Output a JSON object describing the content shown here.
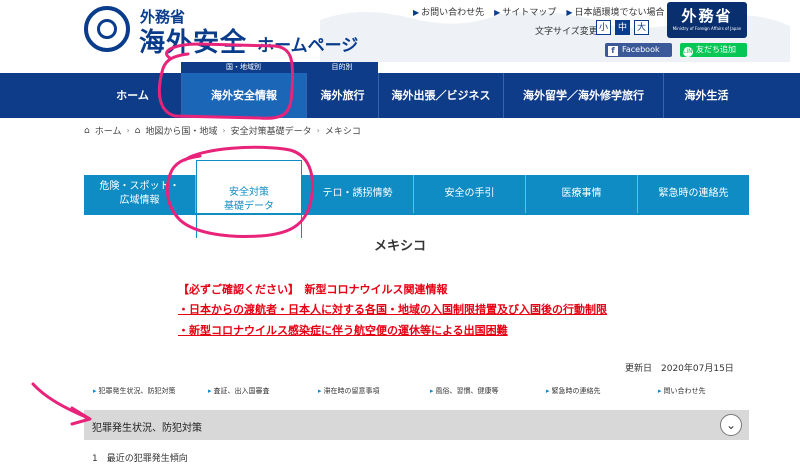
{
  "header": {
    "logo_small": "外務省",
    "logo_big": "海外安全",
    "logo_sub": "ホームページ",
    "links": [
      "お問い合わせ先",
      "サイトマップ",
      "日本語環境でない場合"
    ],
    "fontsize_label": "文字サイズ変更",
    "fontsize_options": [
      "小",
      "中",
      "大"
    ],
    "mofa_jp": "外務省",
    "mofa_en": "Ministry of Foreign Affairs of Japan",
    "facebook": "Facebook",
    "line": "友だち追加"
  },
  "nav": {
    "cat_region": "国・地域別",
    "cat_purpose": "目的別",
    "items": [
      "ホーム",
      "海外安全情報",
      "海外旅行",
      "海外出張／ビジネス",
      "海外留学／海外修学旅行",
      "海外生活"
    ]
  },
  "breadcrumb": [
    "ホーム",
    "地図から国・地域",
    "安全対策基礎データ",
    "メキシコ"
  ],
  "tabs": [
    {
      "l1": "危険・スポット・",
      "l2": "広域情報"
    },
    {
      "l1": "安全対策",
      "l2": "基礎データ"
    },
    {
      "l1": "テロ・誘拐情勢",
      "l2": ""
    },
    {
      "l1": "安全の手引",
      "l2": ""
    },
    {
      "l1": "医療事情",
      "l2": ""
    },
    {
      "l1": "緊急時の連絡先",
      "l2": ""
    }
  ],
  "page_title": "メキシコ",
  "notice": {
    "heading": "【必ずご確認ください】　新型コロナウイルス関連情報",
    "link1": "・日本からの渡航者・日本人に対する各国・地域の入国制限措置及び入国後の行動制限",
    "link2": "・新型コロナウイルス感染症に伴う航空便の運休等による出国困難"
  },
  "updated": "更新日　2020年07月15日",
  "subnav": [
    "犯罪発生状況、防犯対策",
    "査証、出入国審査",
    "滞在時の留意事項",
    "風俗、習慣、健康等",
    "緊急時の連絡先",
    "問い合わせ先"
  ],
  "section": {
    "title": "犯罪発生状況、防犯対策",
    "item1": "1　最近の犯罪発生傾向"
  },
  "colors": {
    "navy": "#0f3c88",
    "tab_blue": "#0f8cc4",
    "notice_red": "#e60012",
    "annotation_pink": "#e8237a"
  }
}
